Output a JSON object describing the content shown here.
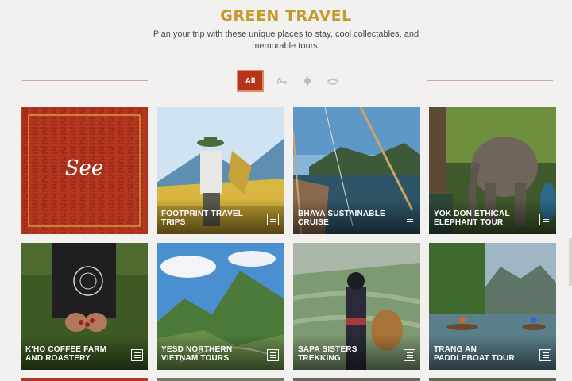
{
  "header": {
    "title": "GREEN TRAVEL",
    "subtitle": "Plan your trip with these unique places to stay, cool collectables, and memorable tours."
  },
  "filters": {
    "all_label": "All",
    "icons": [
      "stay-icon",
      "collectable-icon",
      "tour-icon"
    ]
  },
  "see_card": {
    "label": "See",
    "color": "#b5361e"
  },
  "cards": [
    {
      "label": "Footprint Travel Trips"
    },
    {
      "label": "Bhaya Sustainable Cruise"
    },
    {
      "label": "Yok Don Ethical Elephant Tour"
    },
    {
      "label": "K'Ho Coffee Farm and Roastery"
    },
    {
      "label": "YESD Northern Vietnam Tours"
    },
    {
      "label": "Sapa Sisters Trekking"
    },
    {
      "label": "Trang An Paddleboat Tour"
    }
  ],
  "colors": {
    "accent": "#c49a2c",
    "brand_red": "#b5351b"
  }
}
